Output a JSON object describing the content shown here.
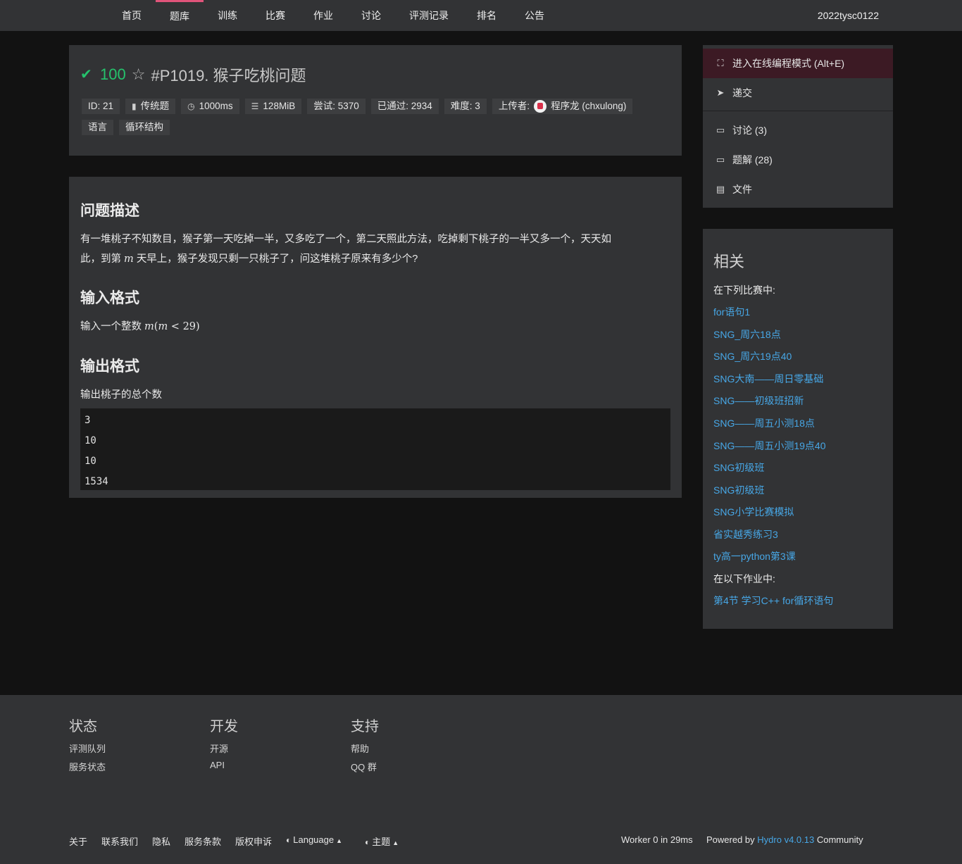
{
  "nav": {
    "items": [
      {
        "label": "首页"
      },
      {
        "label": "题库"
      },
      {
        "label": "训练"
      },
      {
        "label": "比赛"
      },
      {
        "label": "作业"
      },
      {
        "label": "讨论"
      },
      {
        "label": "评测记录"
      },
      {
        "label": "排名"
      },
      {
        "label": "公告"
      }
    ],
    "active_index": 1,
    "user": "2022tysc0122"
  },
  "problem": {
    "score": "100",
    "title": "#P1019. 猴子吃桃问题",
    "tags_row1": {
      "id": "ID: 21",
      "type": "传统题",
      "time": "1000ms",
      "memory": "128MiB",
      "tried": "尝试: 5370",
      "passed": "已通过: 2934",
      "difficulty": "难度: 3",
      "uploader_label": "上传者:",
      "uploader": "程序龙 (chxulong)"
    },
    "tags_row2": [
      "语言",
      "循环结构"
    ]
  },
  "content": {
    "desc_heading": "问题描述",
    "desc_line1": "有一堆桃子不知数目，猴子第一天吃掉一半，又多吃了一个，第二天照此方法，吃掉剩下桃子的一半又多一个，天天如",
    "desc_line2_a": "此，到第",
    "desc_line2_var": "m",
    "desc_line2_b": "天早上，猴子发现只剩一只桃子了，问这堆桃子原来有多少个?",
    "input_heading": "输入格式",
    "input_text": "输入一个整数",
    "input_math_m": "m",
    "input_math_paren": "(",
    "input_math_m2": "m",
    "input_math_rest": " < 29)",
    "output_heading": "输出格式",
    "output_text": "输出桃子的总个数",
    "code_lines": [
      "3",
      "10",
      "10",
      "1534"
    ]
  },
  "sidebar": {
    "menu": [
      {
        "label": "进入在线编程模式 (Alt+E)",
        "icon": "expand-icon"
      },
      {
        "label": "递交",
        "icon": "send-icon"
      },
      {
        "label": "讨论 (3)",
        "icon": "comment-icon"
      },
      {
        "label": "题解 (28)",
        "icon": "comment-icon"
      },
      {
        "label": "文件",
        "icon": "file-icon"
      }
    ],
    "related_title": "相关",
    "contests_label": "在下列比赛中:",
    "contests": [
      "for语句1",
      "SNG_周六18点",
      "SNG_周六19点40",
      "SNG大南——周日零基础",
      "SNG——初级班招新",
      "SNG——周五小测18点",
      "SNG——周五小测19点40",
      "SNG初级班",
      "SNG初级班",
      "SNG小学比赛模拟",
      "省实越秀练习3",
      "ty高一python第3课"
    ],
    "homework_label": "在以下作业中:",
    "homework": [
      "第4节 学习C++ for循环语句"
    ]
  },
  "footer": {
    "cols": [
      {
        "title": "状态",
        "links": [
          "评测队列",
          "服务状态"
        ]
      },
      {
        "title": "开发",
        "links": [
          "开源",
          "API"
        ]
      },
      {
        "title": "支持",
        "links": [
          "帮助",
          "QQ 群"
        ]
      }
    ],
    "bottom_links": [
      "关于",
      "联系我们",
      "隐私",
      "服务条款",
      "版权申诉"
    ],
    "language": "Language",
    "theme": "主题",
    "worker": "Worker 0 in 29ms",
    "powered_prefix": "Powered by",
    "powered_name": "Hydro v4.0.13",
    "powered_suffix": "Community"
  },
  "colors": {
    "accent": "#e0547a",
    "success": "#25c26c",
    "link": "#47a7e6",
    "panel": "#323335",
    "background": "#121212"
  }
}
